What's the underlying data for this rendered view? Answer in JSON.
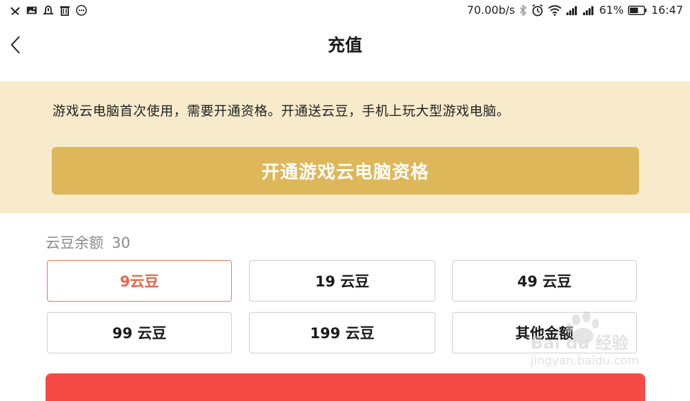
{
  "status_bar": {
    "speed": "70.00b/s",
    "battery_percent": "61%",
    "time": "16:47",
    "battery_level": 0.61,
    "left_icons": [
      "signal-off-icon",
      "image-icon",
      "alarm-notification-icon",
      "trash-icon",
      "more-icon"
    ],
    "right_icons": [
      "bluetooth-icon",
      "alarm-clock-icon",
      "wifi-icon",
      "cell-signal-1-icon",
      "cell-signal-2-icon",
      "battery-icon"
    ]
  },
  "header": {
    "title": "充值",
    "back_icon": "chevron-left-icon"
  },
  "banner": {
    "text": "游戏云电脑首次使用，需要开通资格。开通送云豆，手机上玩大型游戏电脑。",
    "button_label": "开通游戏云电脑资格",
    "background": "#f7ebcb",
    "button_color": "#ddb75a"
  },
  "balance": {
    "label": "云豆余额",
    "value": "30"
  },
  "options": [
    {
      "label": "9云豆",
      "selected": true
    },
    {
      "label": "19 云豆",
      "selected": false
    },
    {
      "label": "49 云豆",
      "selected": false
    },
    {
      "label": "99 云豆",
      "selected": false
    },
    {
      "label": "199 云豆",
      "selected": false
    },
    {
      "label": "其他金额",
      "selected": false
    }
  ],
  "watermark": {
    "brand": "Bai du 经验",
    "url": "jingyan.baidu.com"
  },
  "colors": {
    "selected_border": "#e8765b",
    "pay_button": "#f54a45"
  }
}
